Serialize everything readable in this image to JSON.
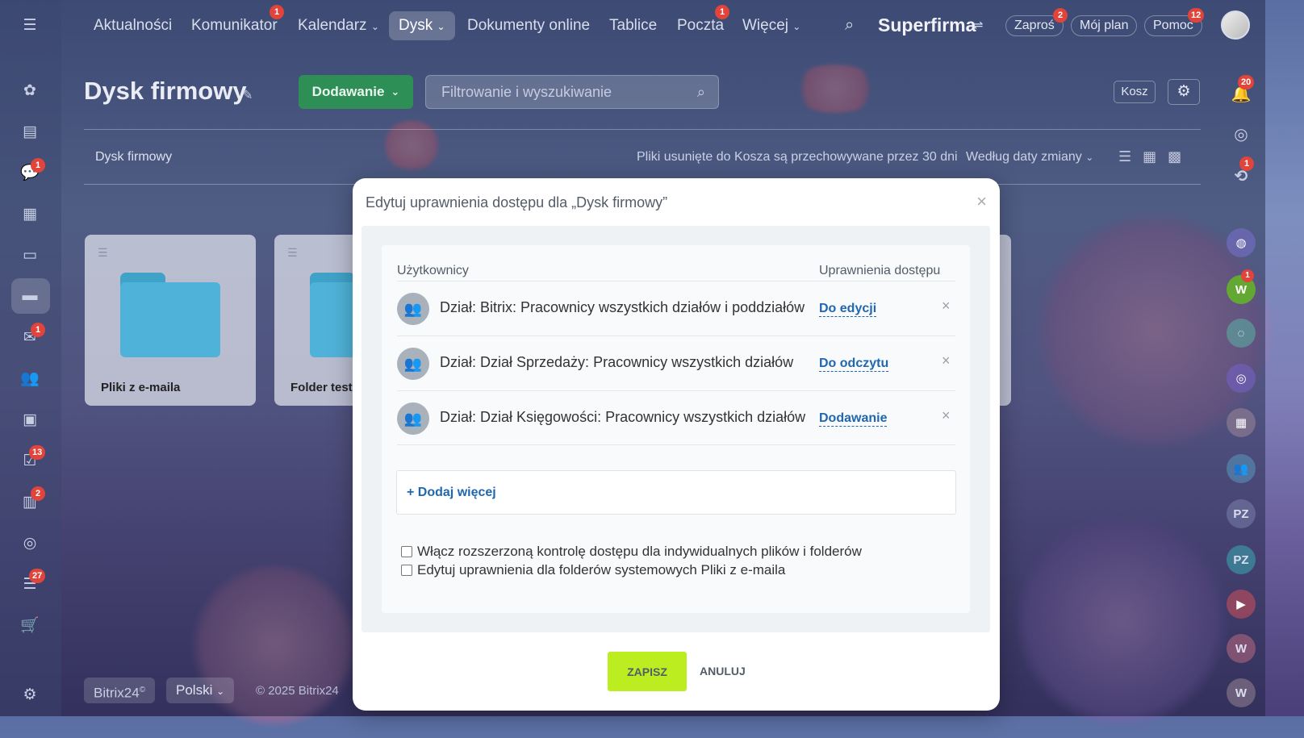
{
  "topnav": {
    "items": [
      "Aktualności",
      "Komunikator",
      "Kalendarz",
      "Dysk",
      "Dokumenty online",
      "Tablice",
      "Poczta",
      "Więcej"
    ],
    "badges": {
      "komunikator": "1",
      "poczta": "1"
    },
    "brand": "Superfirma",
    "invite": "Zaproś",
    "invite_badge": "2",
    "plan": "Mój plan",
    "help": "Pomoc",
    "help_badge": "12"
  },
  "sidebar": {
    "badges": {
      "chat": "1",
      "mail": "1",
      "tasks": "13",
      "crm": "2",
      "funnel": "27"
    }
  },
  "page": {
    "title": "Dysk firmowy",
    "add_button": "Dodawanie",
    "search_placeholder": "Filtrowanie i wyszukiwanie",
    "trash": "Kosz",
    "breadcrumb": "Dysk firmowy",
    "retention_note": "Pliki usunięte do Kosza są przechowywane przez 30 dni",
    "sort": "Według daty zmiany"
  },
  "folders": [
    {
      "name": "Pliki z e-maila"
    },
    {
      "name": "Folder testo"
    }
  ],
  "footer": {
    "brand": "Bitrix24",
    "lang": "Polski",
    "copyright": "© 2025 Bitrix24"
  },
  "rightbar": {
    "notif_badge": "20",
    "sync_badge": "1",
    "w_badge": "1",
    "w_label": "W",
    "pz1": "PZ",
    "pz2": "PZ",
    "w2": "W",
    "w3": "W"
  },
  "modal": {
    "title": "Edytuj uprawnienia dostępu dla „Dysk firmowy”",
    "col_users": "Użytkownicy",
    "col_access": "Uprawnienia dostępu",
    "rows": [
      {
        "label": "Dział: Bitrix: Pracownicy wszystkich działów i poddziałów",
        "perm": "Do edycji"
      },
      {
        "label": "Dział: Dział Sprzedaży: Pracownicy wszystkich działów",
        "perm": "Do odczytu"
      },
      {
        "label": "Dział: Dział Księgowości: Pracownicy wszystkich działów",
        "perm": "Dodawanie"
      }
    ],
    "add_more": "Dodaj więcej",
    "check1": "Włącz rozszerzoną kontrolę dostępu dla indywidualnych plików i folderów",
    "check2": "Edytuj uprawnienia dla folderów systemowych Pliki z e-maila",
    "save": "ZAPISZ",
    "cancel": "ANULUJ"
  }
}
